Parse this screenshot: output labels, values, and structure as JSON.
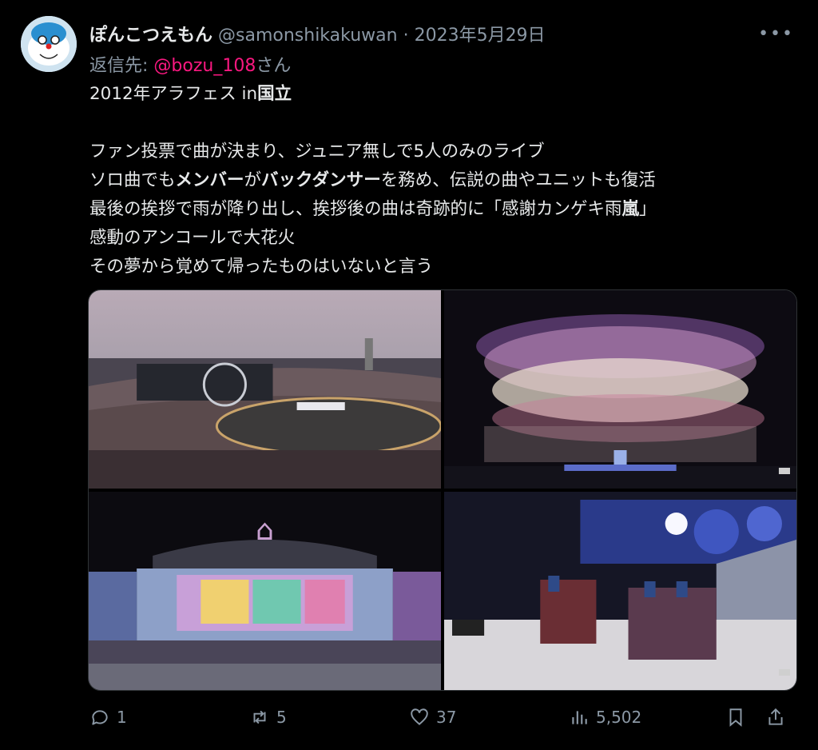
{
  "tweet": {
    "display_name": "ぽんこつえもん",
    "handle": "@samonshikakuwan",
    "separator": "·",
    "date": "2023年5月29日",
    "replying_label": "返信先:",
    "replying_to": "@bozu_108",
    "replying_suffix": "さん",
    "lines": [
      "2012年アラフェス in国立",
      "",
      "ファン投票で曲が決まり、ジュニア無しで5人のみのライブ",
      "ソロ曲でもメンバーがバックダンサーを務め、伝説の曲やユニットも復活",
      "最後の挨拶で雨が降り出し、挨拶後の曲は奇跡的に「感謝カンゲキ雨嵐」",
      "感動のアンコールで大花火",
      "その夢から覚めて帰ったものはいないと言う"
    ],
    "media": [
      {
        "icon": "stadium-photo"
      },
      {
        "icon": "fireworks-photo"
      },
      {
        "icon": "stage-photo"
      },
      {
        "icon": "dancers-photo"
      }
    ]
  },
  "actions": {
    "reply_count": "1",
    "retweet_count": "5",
    "like_count": "37",
    "view_count": "5,502"
  },
  "colors": {
    "background": "#000000",
    "text": "#e7e9ea",
    "muted": "#8b98a5",
    "mention": "#f91880"
  }
}
